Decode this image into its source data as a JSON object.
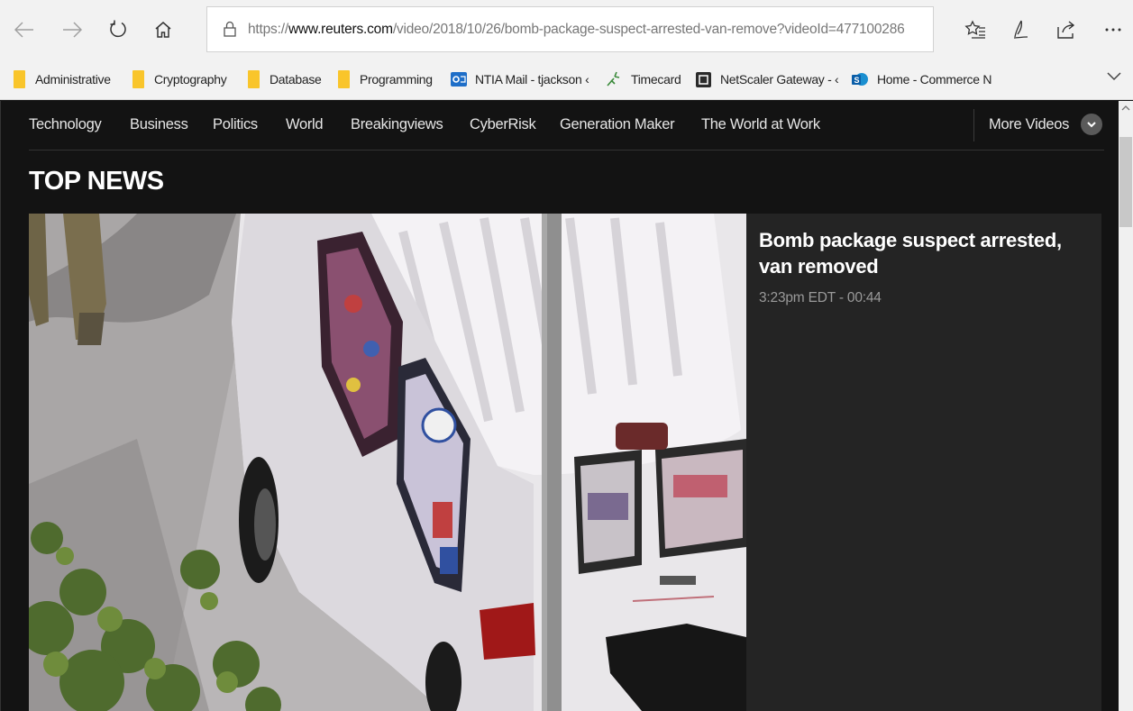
{
  "browser": {
    "url_prefix": "https://",
    "url_domain": "www.reuters.com",
    "url_path": "/video/2018/10/26/bomb-package-suspect-arrested-van-remove?videoId=477100286",
    "bookmarks": [
      {
        "label": "Administrative",
        "icon": "folder-icon"
      },
      {
        "label": "Cryptography",
        "icon": "folder-icon"
      },
      {
        "label": "Database",
        "icon": "folder-icon"
      },
      {
        "label": "Programming",
        "icon": "folder-icon"
      },
      {
        "label": "NTIA Mail - tjackson ‹",
        "icon": "outlook-icon"
      },
      {
        "label": "Timecard",
        "icon": "timecard-icon"
      },
      {
        "label": "NetScaler Gateway - ‹",
        "icon": "netscaler-icon"
      },
      {
        "label": "Home - Commerce N",
        "icon": "sharepoint-icon"
      }
    ]
  },
  "nav": {
    "categories": [
      "Technology",
      "Business",
      "Politics",
      "World",
      "Breakingviews",
      "CyberRisk",
      "Generation Maker",
      "The World at Work"
    ],
    "more_videos": "More Videos"
  },
  "section_title": "TOP NEWS",
  "featured": {
    "headline": "Bomb package suspect arrested, van removed",
    "meta": "3:23pm EDT - 00:44"
  },
  "colors": {
    "page_bg": "#131313",
    "panel_bg": "#242424",
    "folder": "#f9c52b",
    "chrome_bg": "#f2f2f2"
  }
}
